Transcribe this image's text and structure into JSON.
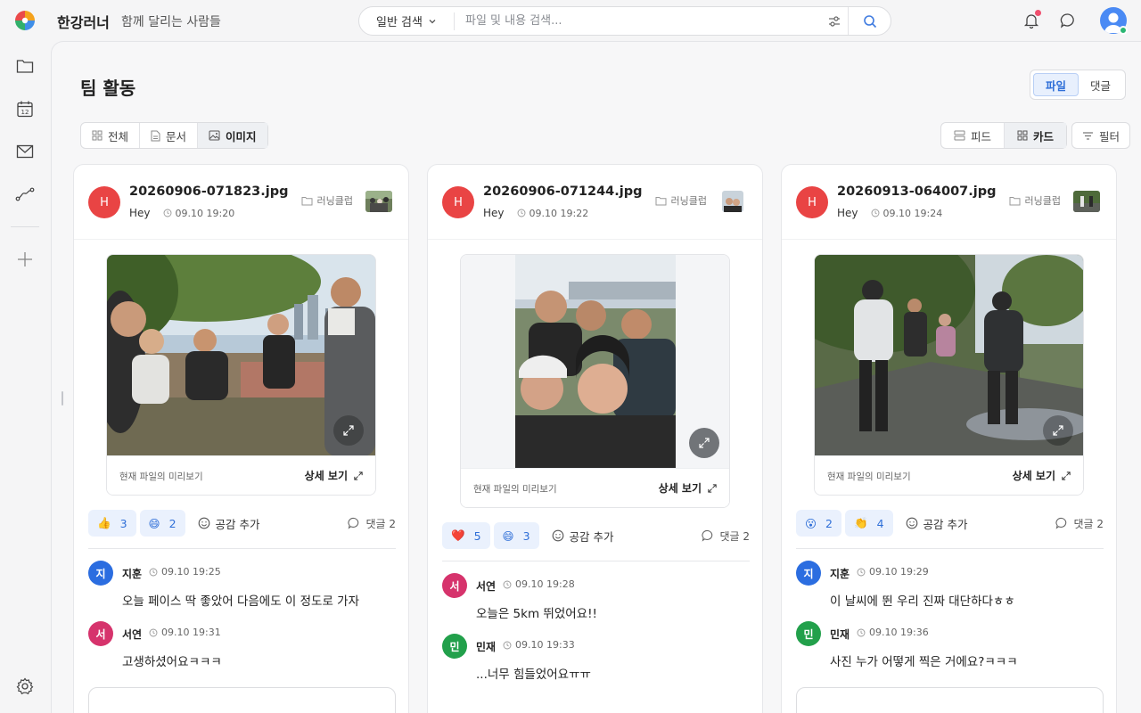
{
  "app": {
    "name": "한강러너",
    "tagline": "함께 달리는 사람들"
  },
  "search": {
    "scope": "일반 검색",
    "placeholder": "파일 및 내용 검색..."
  },
  "page": {
    "title": "팀 활동"
  },
  "view_toggle": {
    "files": "파일",
    "comments": "댓글"
  },
  "type_tabs": {
    "all": "전체",
    "docs": "문서",
    "images": "이미지"
  },
  "layout_tabs": {
    "feed": "피드",
    "card": "카드"
  },
  "filter_label": "필터",
  "labels": {
    "preview": "현재 파일의 미리보기",
    "detail": "상세 보기",
    "add_reaction": "공감 추가"
  },
  "cards": [
    {
      "avatar": "H",
      "filename": "20260906-071823.jpg",
      "user": "Hey",
      "time": "09.10 19:20",
      "folder": "러닝클럽",
      "reactions": [
        {
          "emoji": "👍",
          "count": "3"
        },
        {
          "emoji": "😄",
          "count": "2"
        }
      ],
      "comments_label": "댓글 2",
      "comments": [
        {
          "initial": "지",
          "name": "지훈",
          "time": "09.10 19:25",
          "text": "오늘 페이스 딱 좋았어 다음에도 이 정도로 가자",
          "color": "#2b6de0"
        },
        {
          "initial": "서",
          "name": "서연",
          "time": "09.10 19:31",
          "text": "고생하셨어요ㅋㅋㅋ",
          "color": "#d6336c"
        }
      ]
    },
    {
      "avatar": "H",
      "filename": "20260906-071244.jpg",
      "user": "Hey",
      "time": "09.10 19:22",
      "folder": "러닝클럽",
      "reactions": [
        {
          "emoji": "❤️",
          "count": "5"
        },
        {
          "emoji": "😄",
          "count": "3"
        }
      ],
      "comments_label": "댓글 2",
      "comments": [
        {
          "initial": "서",
          "name": "서연",
          "time": "09.10 19:28",
          "text": "오늘은 5km 뛰었어요!!",
          "color": "#d6336c"
        },
        {
          "initial": "민",
          "name": "민재",
          "time": "09.10 19:33",
          "text": "...너무 힘들었어요ㅠㅠ",
          "color": "#22a04b"
        }
      ]
    },
    {
      "avatar": "H",
      "filename": "20260913-064007.jpg",
      "user": "Hey",
      "time": "09.10 19:24",
      "folder": "러닝클럽",
      "reactions": [
        {
          "emoji": "😮",
          "count": "2"
        },
        {
          "emoji": "👏",
          "count": "4"
        }
      ],
      "comments_label": "댓글 2",
      "comments": [
        {
          "initial": "지",
          "name": "지훈",
          "time": "09.10 19:29",
          "text": "이 날씨에 뛴 우리 진짜 대단하다ㅎㅎ",
          "color": "#2b6de0"
        },
        {
          "initial": "민",
          "name": "민재",
          "time": "09.10 19:36",
          "text": "사진 누가 어떻게 찍은 거에요?ㅋㅋㅋ",
          "color": "#22a04b"
        }
      ]
    }
  ]
}
